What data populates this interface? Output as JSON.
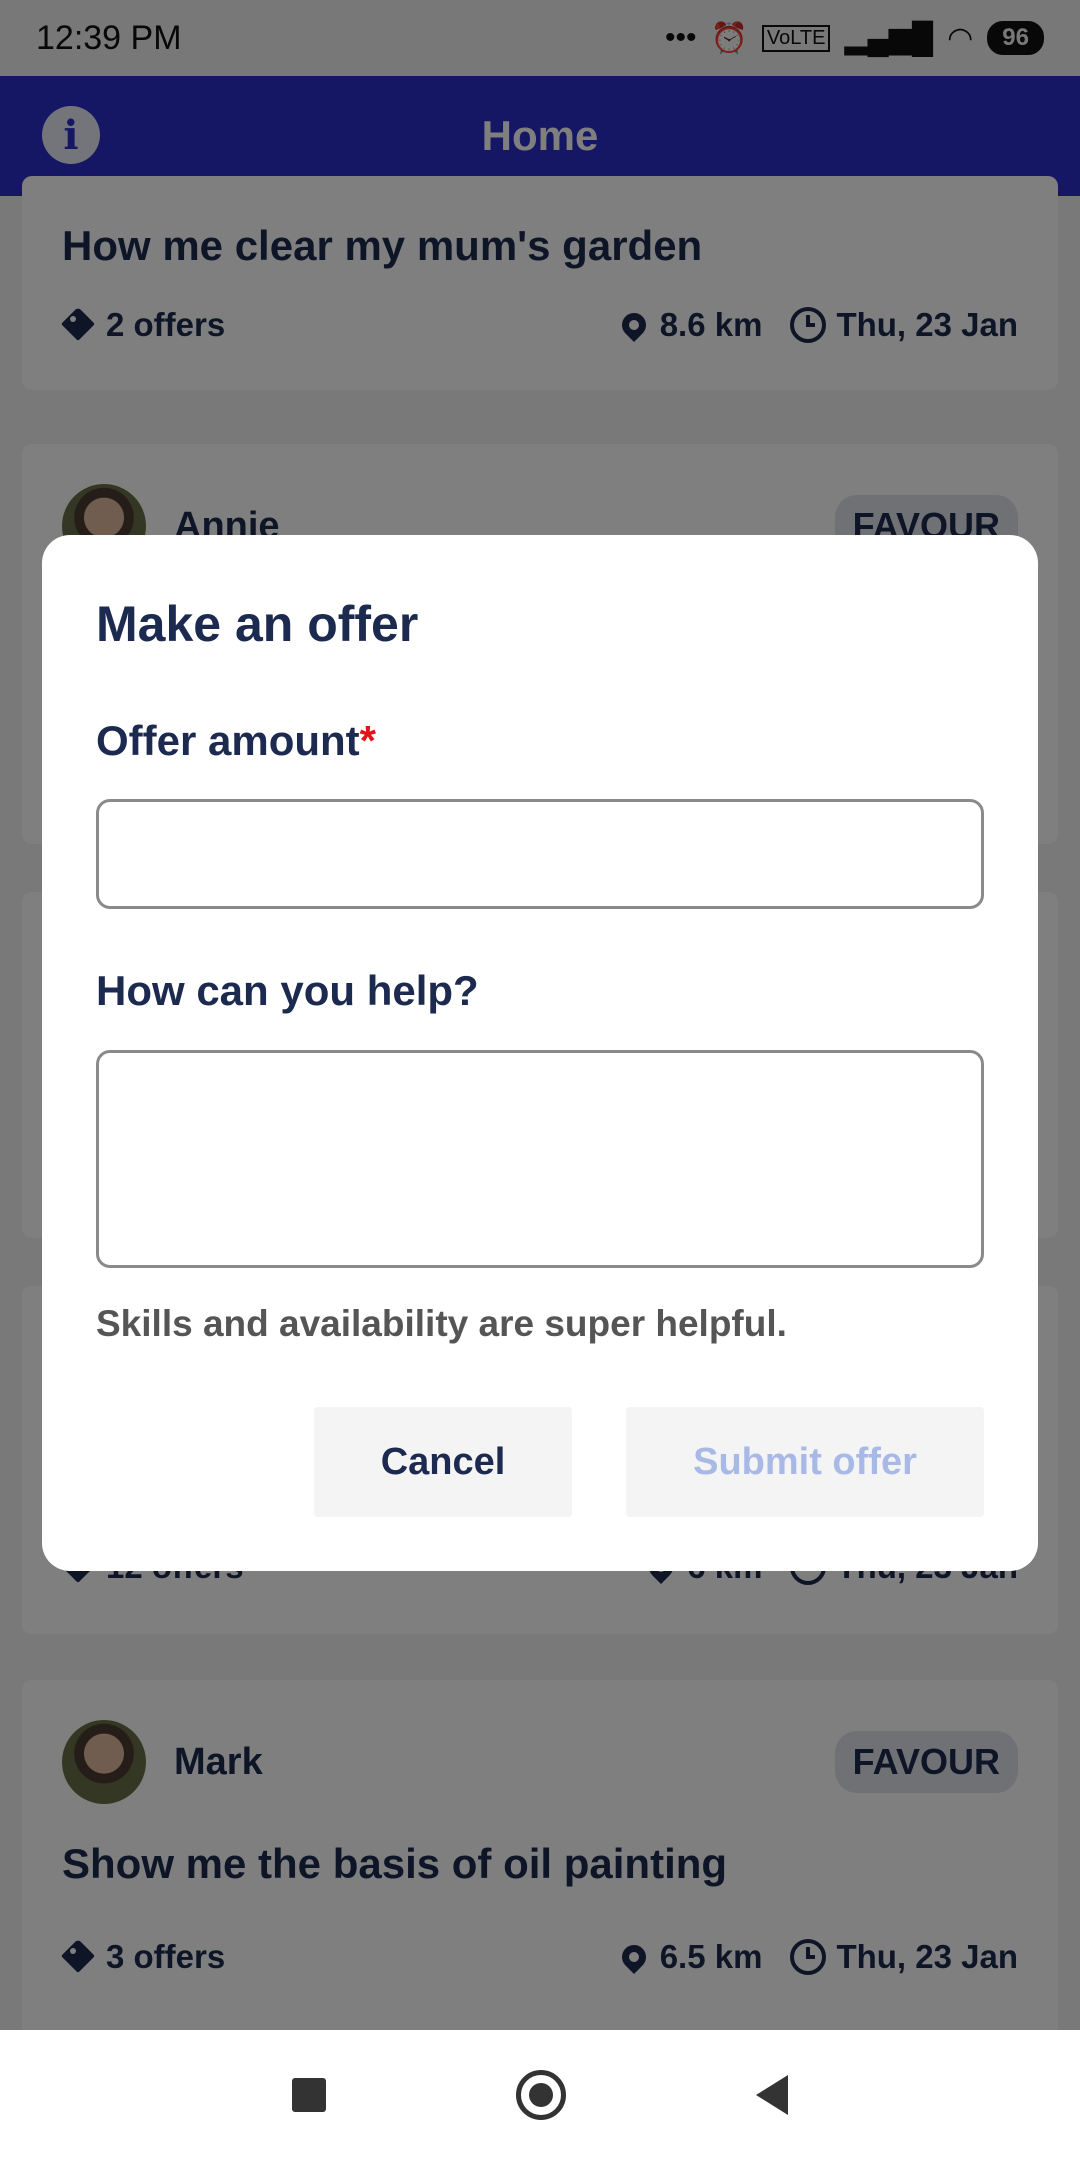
{
  "status_bar": {
    "time": "12:39 PM",
    "icons": [
      "dots-icon",
      "alarm-icon",
      "volte-icon",
      "signal-icon",
      "wifi-icon",
      "battery-icon"
    ],
    "battery": "96"
  },
  "app_bar": {
    "title": "Home",
    "info_icon": "info-icon"
  },
  "feed": {
    "cards": [
      {
        "title": "How me clear my mum's garden",
        "offers": "2 offers",
        "distance": "8.6 km",
        "date": "Thu, 23 Jan"
      },
      {
        "user": "Annie",
        "badge": "FAVOUR"
      },
      {
        "offers": "12 offers",
        "distance": "6 km",
        "date": "Thu, 23 Jan"
      },
      {
        "user": "Mark",
        "badge": "FAVOUR",
        "title": "Show me the basis of oil painting",
        "offers": "3 offers",
        "distance": "6.5 km",
        "date": "Thu, 23 Jan"
      }
    ]
  },
  "dialog": {
    "title": "Make an offer",
    "offer_label": "Offer amount",
    "required_mark": "*",
    "offer_value": "",
    "help_label": "How can you help?",
    "help_value": "",
    "hint": "Skills and availability are super helpful.",
    "cancel_label": "Cancel",
    "submit_label": "Submit offer"
  },
  "colors": {
    "app_bar": "#2b2ec8",
    "text_dark": "#1c2a4f",
    "required": "#e0131b",
    "submit_disabled": "#a9b9e6"
  }
}
